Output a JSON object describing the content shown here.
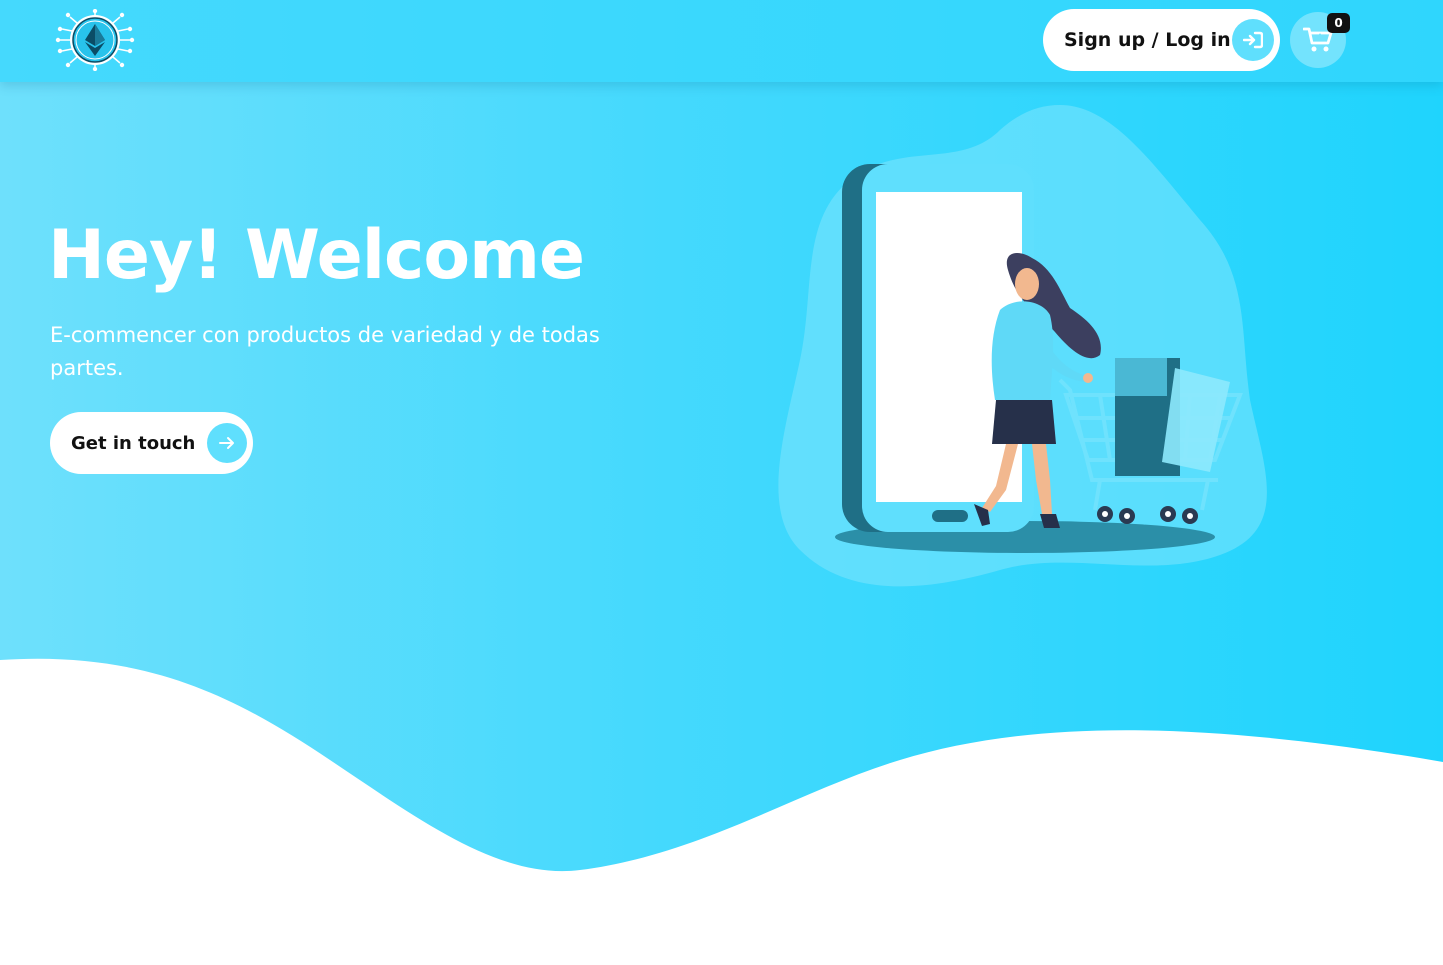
{
  "header": {
    "login_label": "Sign up / Log in",
    "cart_count": "0"
  },
  "hero": {
    "title": "Hey! Welcome",
    "subtitle": "E-commencer con productos de variedad y de todas partes.",
    "cta_label": "Get in touch"
  },
  "icons": {
    "logo": "ethereum-logo-icon",
    "login": "sign-in-icon",
    "cart": "cart-plus-icon",
    "cta": "arrow-right-icon"
  },
  "colors": {
    "primary": "#2fd6fd",
    "accent": "#5fdffd",
    "text_dark": "#111111",
    "white": "#ffffff",
    "badge": "#111111"
  }
}
